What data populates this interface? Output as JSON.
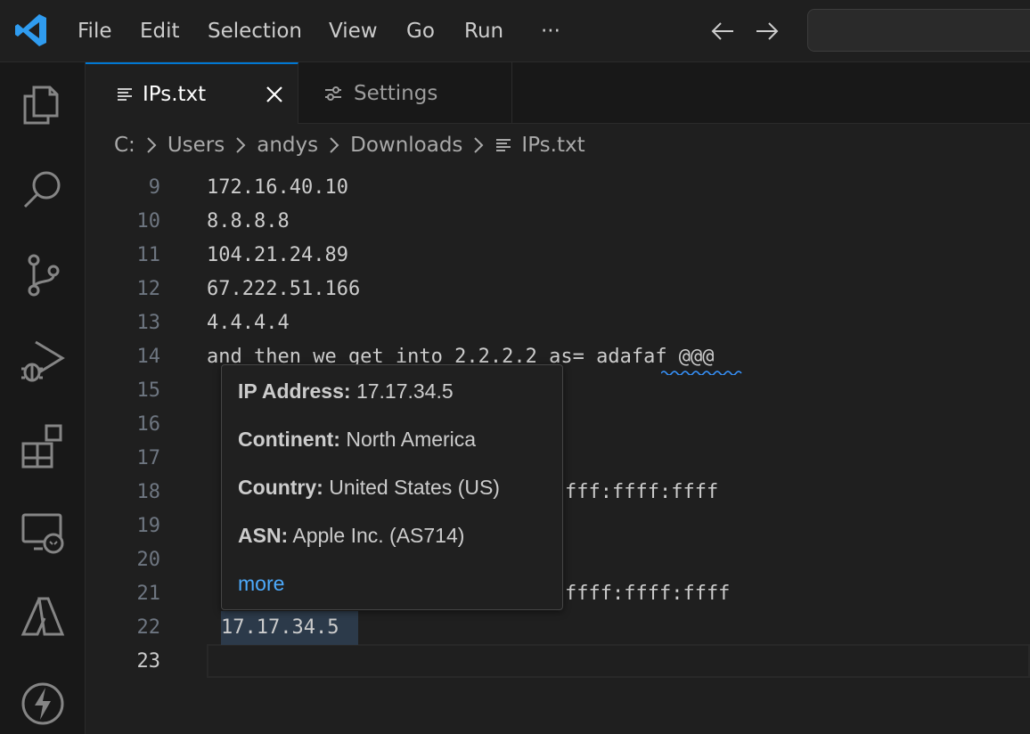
{
  "menu": [
    "File",
    "Edit",
    "Selection",
    "View",
    "Go",
    "Run",
    "···"
  ],
  "colors": {
    "accent": "#0078d4",
    "link": "#4daafc",
    "logo": "#2f9cf0"
  },
  "tabs": [
    {
      "label": "IPs.txt",
      "icon": "lines-icon",
      "close": "close-icon"
    },
    {
      "label": "Settings",
      "icon": "settings-sliders-icon"
    }
  ],
  "breadcrumb": [
    "C:",
    "Users",
    "andys",
    "Downloads",
    "IPs.txt"
  ],
  "editor": {
    "lines": [
      {
        "num": "9",
        "text": "172.16.40.10"
      },
      {
        "num": "10",
        "text": "8.8.8.8"
      },
      {
        "num": "11",
        "text": "104.21.24.89"
      },
      {
        "num": "12",
        "text": "67.222.51.166"
      },
      {
        "num": "13",
        "text": "4.4.4.4"
      },
      {
        "num": "14",
        "text": "and then we get into 2.2.2.2 as= adafaf @@@"
      },
      {
        "num": "15",
        "text": ""
      },
      {
        "num": "16",
        "text": ""
      },
      {
        "num": "17",
        "text": ""
      },
      {
        "num": "18",
        "text": "fff:ffff:ffff"
      },
      {
        "num": "19",
        "text": ""
      },
      {
        "num": "20",
        "text": ""
      },
      {
        "num": "21",
        "text": "ffff:ffff:ffff"
      },
      {
        "num": "22",
        "text": "17.17.34.5"
      },
      {
        "num": "23",
        "text": ""
      }
    ]
  },
  "hover": {
    "ip_label": "IP Address:",
    "ip_value": "17.17.34.5",
    "continent_label": "Continent:",
    "continent_value": "North America",
    "country_label": "Country:",
    "country_value": "United States (US)",
    "asn_label": "ASN:",
    "asn_value": "Apple Inc. (AS714)",
    "more": "more"
  }
}
